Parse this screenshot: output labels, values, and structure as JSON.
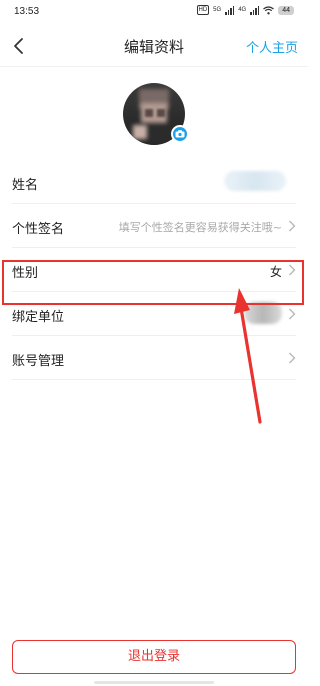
{
  "status_bar": {
    "time": "13:53",
    "hd_label": "HD",
    "network_1": "5G",
    "network_2": "4G",
    "battery": "44",
    "wifi_icon": "wifi-icon",
    "signal_icon": "signal-bars-icon"
  },
  "nav": {
    "back_icon": "chevron-left-icon",
    "title": "编辑资料",
    "right_link": "个人主页"
  },
  "avatar": {
    "camera_icon": "camera-icon",
    "badge_color": "#1aa3e8"
  },
  "rows": [
    {
      "label": "姓名",
      "value": ""
    },
    {
      "label": "个性签名",
      "placeholder": "填写个性签名更容易获得关注哦~"
    },
    {
      "label": "性别",
      "value": "女"
    },
    {
      "label": "绑定单位",
      "value": ""
    },
    {
      "label": "账号管理",
      "value": ""
    }
  ],
  "logout": {
    "label": "退出登录"
  },
  "colors": {
    "accent": "#1aa3e8",
    "danger": "#e8332f",
    "placeholder": "#a8a8a8"
  }
}
